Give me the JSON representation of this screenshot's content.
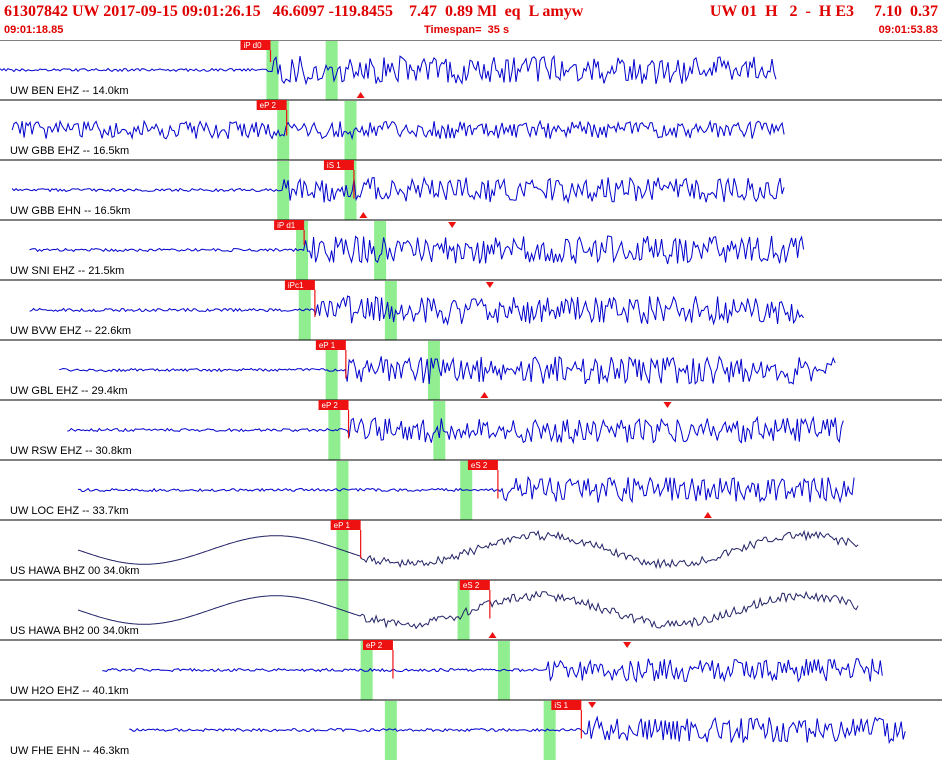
{
  "header": {
    "title": "61307842 UW 2017-09-15 09:01:26.15   46.6097 -119.8455    7.47  0.89 Ml  eq  L amyw",
    "title_right": "UW 01  H   2  -  H E3     7.10  0.37",
    "start_time": "09:01:18.85",
    "timespan_label": "Timespan=  35 s",
    "end_time": "09:01:53.83"
  },
  "colors": {
    "header_text": "#e00000",
    "trace_uw": "#0000cc",
    "trace_us": "#222266",
    "pick_box": "#ee1111",
    "window_green": "#90ee90",
    "divider": "#000000"
  },
  "traces": [
    {
      "label": "UW BEN EHZ -- 14.0km",
      "pick_label": "iP d0",
      "pick_sec": 10.05,
      "pick_len": 0.4,
      "start_sec": 0.0,
      "end_sec": 28.9,
      "green1_sec": 9.9,
      "green2_sec": 12.1,
      "tri_sec": 13.4,
      "tri_bottom": true,
      "quiet_end": 10.05,
      "amp": 0.55,
      "type": "uw"
    },
    {
      "label": "UW GBB EHZ -- 16.5km",
      "pick_label": "eP 2",
      "pick_sec": 10.65,
      "pick_len": 0.85,
      "start_sec": 0.45,
      "end_sec": 29.2,
      "green1_sec": 10.3,
      "green2_sec": 12.8,
      "tri_sec": null,
      "tri_bottom": false,
      "quiet_end": 0.4,
      "amp": 0.35,
      "type": "uw"
    },
    {
      "label": "UW GBB EHN -- 16.5km",
      "pick_label": "iS 1",
      "pick_sec": 13.15,
      "pick_len": 0.95,
      "start_sec": 0.45,
      "end_sec": 29.2,
      "green1_sec": 10.3,
      "green2_sec": 12.8,
      "tri_sec": 13.5,
      "tri_bottom": true,
      "quiet_end": 10.5,
      "amp": 0.5,
      "type": "uw"
    },
    {
      "label": "UW SNI EHZ -- 21.5km",
      "pick_label": "iP d1",
      "pick_sec": 11.3,
      "pick_len": 0.5,
      "start_sec": 1.1,
      "end_sec": 29.9,
      "green1_sec": 11.0,
      "green2_sec": 13.9,
      "tri_sec": 16.8,
      "tri_bottom": false,
      "quiet_end": 11.3,
      "amp": 0.55,
      "type": "uw"
    },
    {
      "label": "UW BVW EHZ -- 22.6km",
      "pick_label": "iPc1",
      "pick_sec": 11.7,
      "pick_len": 0.9,
      "start_sec": 1.1,
      "end_sec": 29.9,
      "green1_sec": 11.1,
      "green2_sec": 14.3,
      "tri_sec": 18.2,
      "tri_bottom": false,
      "quiet_end": 11.7,
      "amp": 0.55,
      "type": "uw"
    },
    {
      "label": "UW GBL EHZ -- 29.4km",
      "pick_label": "eP 1",
      "pick_sec": 12.85,
      "pick_len": 0.95,
      "start_sec": 2.2,
      "end_sec": 31.1,
      "green1_sec": 12.1,
      "green2_sec": 15.9,
      "tri_sec": 18.0,
      "tri_bottom": true,
      "quiet_end": 12.85,
      "amp": 0.55,
      "type": "uw"
    },
    {
      "label": "UW RSW EHZ -- 30.8km",
      "pick_label": "eP 2",
      "pick_sec": 12.95,
      "pick_len": 0.95,
      "start_sec": 2.5,
      "end_sec": 31.4,
      "green1_sec": 12.2,
      "green2_sec": 16.1,
      "tri_sec": 24.8,
      "tri_bottom": false,
      "quiet_end": 12.95,
      "amp": 0.5,
      "type": "uw"
    },
    {
      "label": "UW LOC EHZ -- 33.7km",
      "pick_label": "eS 2",
      "pick_sec": 18.5,
      "pick_len": 0.95,
      "start_sec": 2.9,
      "end_sec": 31.8,
      "green1_sec": 12.5,
      "green2_sec": 17.1,
      "tri_sec": 26.3,
      "tri_bottom": true,
      "quiet_end": 18.5,
      "amp": 0.5,
      "type": "uw"
    },
    {
      "label": "US HAWA BHZ 00 34.0km",
      "pick_label": "eP 1",
      "pick_sec": 13.4,
      "pick_len": 0.95,
      "start_sec": 2.9,
      "end_sec": 31.9,
      "green1_sec": 12.5,
      "green2_sec": null,
      "tri_sec": null,
      "tri_bottom": false,
      "quiet_end": 13.4,
      "amp": 0.65,
      "type": "us"
    },
    {
      "label": "US HAWA BH2 00 34.0km",
      "pick_label": "eS 2",
      "pick_sec": 18.2,
      "pick_len": 0.95,
      "start_sec": 2.9,
      "end_sec": 31.9,
      "green1_sec": 12.5,
      "green2_sec": 17.0,
      "tri_sec": 18.3,
      "tri_bottom": true,
      "quiet_end": 13.4,
      "amp": 0.65,
      "type": "us"
    },
    {
      "label": "UW H2O EHZ -- 40.1km",
      "pick_label": "eP 2",
      "pick_sec": 14.6,
      "pick_len": 0.95,
      "start_sec": 3.8,
      "end_sec": 32.8,
      "green1_sec": 13.4,
      "green2_sec": 18.5,
      "tri_sec": 23.3,
      "tri_bottom": false,
      "quiet_end": 20.3,
      "amp": 0.45,
      "type": "uw"
    },
    {
      "label": "UW FHE EHN -- 46.3km",
      "pick_label": "iS 1",
      "pick_sec": 21.6,
      "pick_len": 0.95,
      "start_sec": 4.8,
      "end_sec": 33.7,
      "green1_sec": 14.3,
      "green2_sec": 20.2,
      "tri_sec": 22.0,
      "tri_bottom": false,
      "quiet_end": 21.6,
      "amp": 0.5,
      "type": "uw"
    }
  ]
}
